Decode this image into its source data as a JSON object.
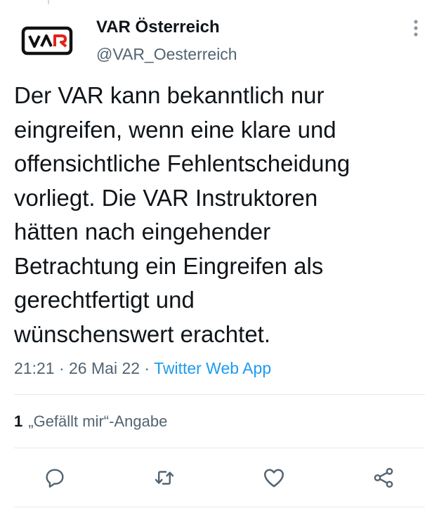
{
  "account": {
    "display_name": "VAR Österreich",
    "handle": "@VAR_Oesterreich",
    "logo_text": "VAR"
  },
  "tweet": {
    "text": "Der VAR kann bekanntlich nur\neingreifen, wenn eine klare und\noffensichtliche Fehlentscheidung\nvorliegt. Die VAR Instruktoren\nhätten nach eingehender\nBetrachtung ein Eingreifen als\ngerechtfertigt und\nwünschenswert erachtet.",
    "time": "21:21",
    "date": "26 Mai 22",
    "separator": " · ",
    "source": "Twitter Web App"
  },
  "stats": {
    "likes_count": "1",
    "likes_label": "„Gefällt mir“-Angabe"
  },
  "icons": {
    "more": "more-vertical-icon",
    "reply": "reply-icon",
    "retweet": "retweet-icon",
    "like": "heart-icon",
    "share": "share-icon"
  },
  "colors": {
    "text": "#0f1419",
    "secondary": "#536471",
    "link": "#1d9bf0",
    "divider": "#e4e9ec",
    "logo_red": "#e2231a"
  }
}
